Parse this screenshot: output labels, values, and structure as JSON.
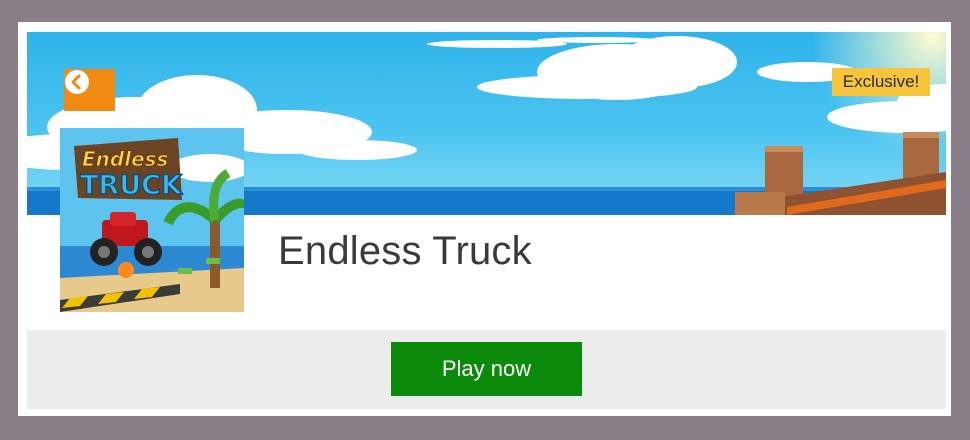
{
  "game": {
    "title": "Endless Truck",
    "badge": "Exclusive!",
    "thumbnail_logo_line1": "Endless",
    "thumbnail_logo_line2": "TRUCK"
  },
  "actions": {
    "back_icon": "chevron-left-icon",
    "play_label": "Play now"
  },
  "colors": {
    "page_background": "#8a7f88",
    "back_button": "#f08a10",
    "badge": "#f6c53a",
    "play_button": "#0b8a0b",
    "footer": "#ececec"
  }
}
